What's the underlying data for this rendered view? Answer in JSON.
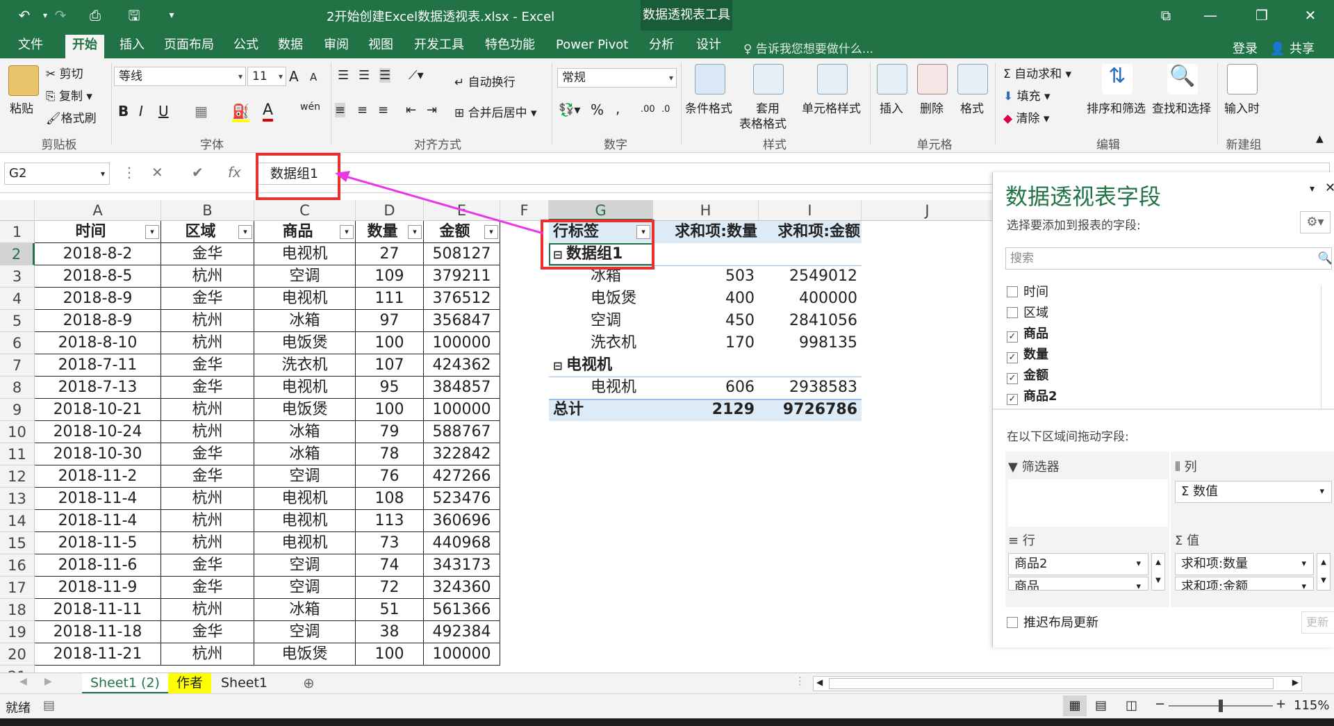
{
  "titlebar": {
    "doc_title": "2开始创建Excel数据透视表.xlsx - Excel",
    "context_title": "数据透视表工具",
    "undo_icon": "↶",
    "redo_icon": "↷",
    "preview_icon": "⎙",
    "save_icon": "🖫",
    "customize_icon": "▾",
    "ribbon_display_icon": "⧉",
    "minimize_icon": "—",
    "restore_icon": "❐",
    "close_icon": "✕"
  },
  "tabs": [
    "文件",
    "开始",
    "插入",
    "页面布局",
    "公式",
    "数据",
    "审阅",
    "视图",
    "开发工具",
    "特色功能",
    "Power Pivot",
    "分析",
    "设计"
  ],
  "active_tab": "开始",
  "tellme": "♀ 告诉我您想要做什么...",
  "login": "登录",
  "share": "共享",
  "ribbon": {
    "clipboard": {
      "paste": "粘贴",
      "cut": "剪切",
      "copy": "复制",
      "format_painter": "格式刷",
      "label": "剪贴板"
    },
    "font": {
      "name": "等线",
      "size": "11",
      "grow": "A",
      "shrink": "A",
      "bold": "B",
      "italic": "I",
      "underline": "U",
      "font_color": "A",
      "phonetic": "wén",
      "label": "字体"
    },
    "alignment": {
      "wrap": "自动换行",
      "merge": "合并后居中",
      "label": "对齐方式"
    },
    "number": {
      "format": "常规",
      "percent": "%",
      "comma": ",",
      "inc": ".00",
      "dec": ".0",
      "label": "数字"
    },
    "styles": {
      "conditional": "条件格式",
      "table_format": "套用",
      "table_format2": "表格格式",
      "cell_styles": "单元格样式",
      "label": "样式"
    },
    "cells": {
      "insert": "插入",
      "delete": "删除",
      "format": "格式",
      "label": "单元格"
    },
    "editing": {
      "autosum": "自动求和",
      "fill": "填充",
      "clear": "清除",
      "sort": "排序和筛选",
      "find": "查找和选择",
      "label": "编辑"
    },
    "newgroup": {
      "input": "输入时",
      "label": "新建组"
    }
  },
  "formula_bar": {
    "name_box": "G2",
    "cancel": "✕",
    "enter": "✔",
    "fx": "fx",
    "content": "数据组1"
  },
  "columns": [
    "A",
    "B",
    "C",
    "D",
    "E",
    "F",
    "G",
    "H",
    "I",
    "J"
  ],
  "table_headers": [
    "时间",
    "区域",
    "商品",
    "数量",
    "金额"
  ],
  "rows": [
    [
      "2018-8-2",
      "金华",
      "电视机",
      "27",
      "508127"
    ],
    [
      "2018-8-5",
      "杭州",
      "空调",
      "109",
      "379211"
    ],
    [
      "2018-8-9",
      "金华",
      "电视机",
      "111",
      "376512"
    ],
    [
      "2018-8-9",
      "杭州",
      "冰箱",
      "97",
      "356847"
    ],
    [
      "2018-8-10",
      "杭州",
      "电饭煲",
      "100",
      "100000"
    ],
    [
      "2018-7-11",
      "金华",
      "洗衣机",
      "107",
      "424362"
    ],
    [
      "2018-7-13",
      "金华",
      "电视机",
      "95",
      "384857"
    ],
    [
      "2018-10-21",
      "杭州",
      "电饭煲",
      "100",
      "100000"
    ],
    [
      "2018-10-24",
      "杭州",
      "冰箱",
      "79",
      "588767"
    ],
    [
      "2018-10-30",
      "金华",
      "冰箱",
      "78",
      "322842"
    ],
    [
      "2018-11-2",
      "金华",
      "空调",
      "76",
      "427266"
    ],
    [
      "2018-11-4",
      "杭州",
      "电视机",
      "108",
      "523476"
    ],
    [
      "2018-11-4",
      "杭州",
      "电视机",
      "113",
      "360696"
    ],
    [
      "2018-11-5",
      "杭州",
      "电视机",
      "73",
      "440968"
    ],
    [
      "2018-11-6",
      "金华",
      "空调",
      "74",
      "343173"
    ],
    [
      "2018-11-9",
      "金华",
      "空调",
      "72",
      "324360"
    ],
    [
      "2018-11-11",
      "杭州",
      "冰箱",
      "51",
      "561366"
    ],
    [
      "2018-11-18",
      "金华",
      "空调",
      "38",
      "492384"
    ],
    [
      "2018-11-21",
      "杭州",
      "电饭煲",
      "100",
      "100000"
    ]
  ],
  "pivot": {
    "row_label": "行标签",
    "col_h": "求和项:数量",
    "col_i": "求和项:金额",
    "groups": [
      {
        "name": "数据组1",
        "items": [
          [
            "冰箱",
            "503",
            "2549012"
          ],
          [
            "电饭煲",
            "400",
            "400000"
          ],
          [
            "空调",
            "450",
            "2841056"
          ],
          [
            "洗衣机",
            "170",
            "998135"
          ]
        ]
      },
      {
        "name": "电视机",
        "items": [
          [
            "电视机",
            "606",
            "2938583"
          ]
        ]
      }
    ],
    "total_label": "总计",
    "total_qty": "2129",
    "total_amt": "9726786"
  },
  "sheet_tabs": [
    "Sheet1 (2)",
    "作者",
    "Sheet1"
  ],
  "status": {
    "ready": "就绪",
    "zoom": "115%"
  },
  "panel": {
    "title": "数据透视表字段",
    "subtitle": "选择要添加到报表的字段:",
    "search": "搜索",
    "fields": [
      {
        "name": "时间",
        "checked": false
      },
      {
        "name": "区域",
        "checked": false
      },
      {
        "name": "商品",
        "checked": true
      },
      {
        "name": "数量",
        "checked": true
      },
      {
        "name": "金额",
        "checked": true
      },
      {
        "name": "商品2",
        "checked": true
      }
    ],
    "drag_hint": "在以下区域间拖动字段:",
    "filter_label": "筛选器",
    "columns_label": "列",
    "columns_item": "Σ 数值",
    "rows_label": "行",
    "values_label": "Σ 值",
    "rows_items": [
      "商品2",
      "商品"
    ],
    "values_items": [
      "求和项:数量",
      "求和项:金额"
    ],
    "defer": "推迟布局更新",
    "update": "更新"
  },
  "colors": {
    "excel_green": "#217346",
    "annotation_red": "#e8312f",
    "arrow_magenta": "#e837e8",
    "pivot_header": "#ddebf7"
  }
}
